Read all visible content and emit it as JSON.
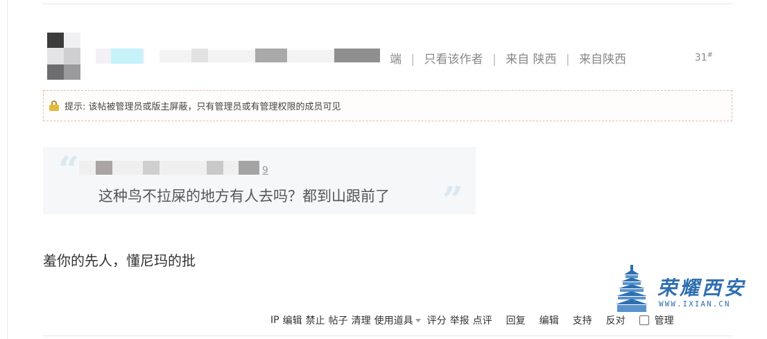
{
  "author_header": {
    "meta_tail": "端",
    "only_author_link": "只看该作者",
    "from_location": "来自 陕西",
    "from_location_2": "来自陕西",
    "floor": "31",
    "floor_mark": "#"
  },
  "notice": {
    "icon": "lock-icon",
    "text": "提示: 该帖被管理员或版主屏蔽，只有管理员或有管理权限的成员可见"
  },
  "quote": {
    "quoted_user_tail": "9",
    "text": "这种鸟不拉屎的地方有人去吗？都到山跟前了"
  },
  "reply": {
    "text": "羞你的先人，懂尼玛的批"
  },
  "watermark": {
    "title": "荣耀西安",
    "url": "WWW.IXIAN.CN",
    "color": "#2f6fb0"
  },
  "actions": {
    "ip": "IP",
    "edit_small": "编辑",
    "ban": "禁止",
    "posts": "帖子",
    "clean": "清理",
    "use_tools": "使用道具",
    "rate": "评分",
    "report": "举报",
    "comment": "点评",
    "reply": "回复",
    "edit": "编辑",
    "support": "支持",
    "oppose": "反对",
    "manage": "管理"
  }
}
